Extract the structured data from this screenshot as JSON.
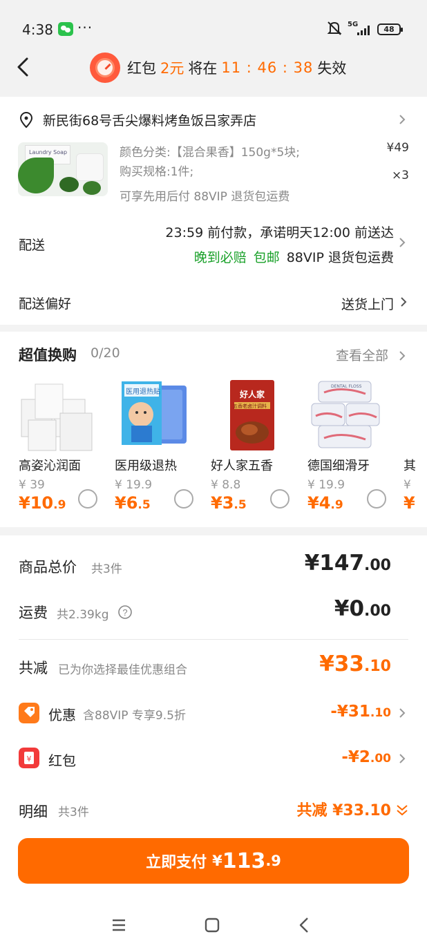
{
  "status_bar": {
    "time": "4:38",
    "more": "···",
    "network": "5G",
    "battery": "48"
  },
  "banner": {
    "prefix": "红包",
    "amount": "2元",
    "mid": "将在",
    "countdown": "11 : 46 : 38",
    "suffix": "失效"
  },
  "address": {
    "text": "新民街68号舌尖爆料烤鱼饭吕家弄店"
  },
  "product": {
    "spec_line": "颜色分类:【混合果香】150g*5块;",
    "spec_line2": "购买规格:1件;",
    "service_line": "可享先用后付  88VIP 退货包运费",
    "price": "¥49",
    "qty": "×3",
    "thumb_label": "Laundry Soap"
  },
  "delivery": {
    "label": "配送",
    "main": "23:59 前付款，承诺明天12:00 前送达",
    "tag1": "晚到必赔",
    "tag2": "包邮",
    "tag3": "88VIP 退货包运费"
  },
  "preference": {
    "label": "配送偏好",
    "value": "送货上门"
  },
  "swap": {
    "title": "超值换购",
    "count": "0/20",
    "view_all": "查看全部",
    "items": [
      {
        "name": "高姿沁润面",
        "old": "¥ 39",
        "new_int": "¥10",
        "new_dec": ".9"
      },
      {
        "name": "医用级退热",
        "old": "¥ 19.9",
        "new_int": "¥6",
        "new_dec": ".5"
      },
      {
        "name": "好人家五香",
        "old": "¥ 8.8",
        "new_int": "¥3",
        "new_dec": ".5"
      },
      {
        "name": "德国细滑牙",
        "old": "¥ 19.9",
        "new_int": "¥4",
        "new_dec": ".9"
      },
      {
        "name": "其",
        "old": "¥",
        "new_int": "¥",
        "new_dec": ""
      }
    ],
    "img_texts": {
      "item2_top": "医用退热贴",
      "item3_brand": "好人家",
      "item3_desc": "五香老卤汁调料",
      "item4_brand": "DENTAL FLOSS"
    }
  },
  "totals": {
    "goods_label": "商品总价",
    "goods_sub": "共3件",
    "goods_int": "¥147",
    "goods_dec": ".00",
    "ship_label": "运费",
    "ship_sub": "共2.39kg",
    "ship_int": "¥0",
    "ship_dec": ".00",
    "reduce_label": "共减",
    "reduce_sub": "已为你选择最佳优惠组合",
    "reduce_int": "¥33",
    "reduce_dec": ".10",
    "discount_label": "优惠",
    "discount_sub": "含88VIP 专享9.5折",
    "discount_int": "-¥31",
    "discount_dec": ".10",
    "redpacket_label": "红包",
    "redpacket_int": "-¥2",
    "redpacket_dec": ".00",
    "detail_label": "明细",
    "detail_sub": "共3件",
    "detail_val": "共减 ¥33.10"
  },
  "pay": {
    "label": "立即支付",
    "currency": "¥",
    "int": "113",
    "dec": ".9"
  },
  "colors": {
    "accent": "#ff6a00",
    "green": "#18a028"
  }
}
